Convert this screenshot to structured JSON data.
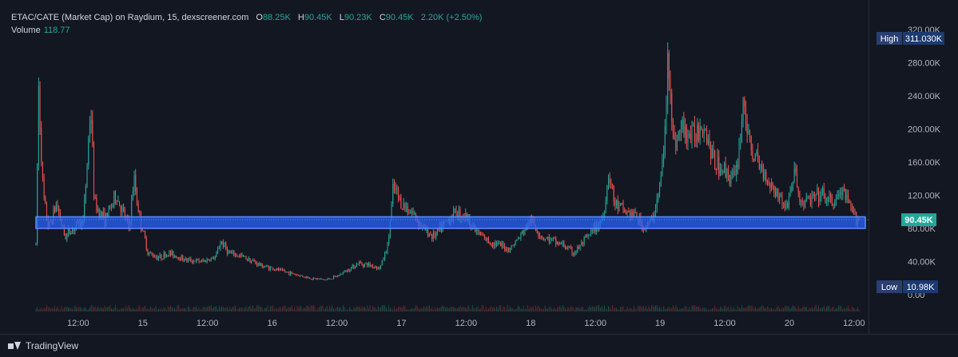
{
  "legend": {
    "symbol": "ETAC/CATE (Market Cap) on Raydium, 15, dexscreener.com",
    "o_key": "O",
    "o_val": "88.25K",
    "h_key": "H",
    "h_val": "90.45K",
    "l_key": "L",
    "l_val": "90.23K",
    "c_key": "C",
    "c_val": "90.45K",
    "change": "2.20K (+2.50%)",
    "volume_label": "Volume",
    "volume_value": "118.77"
  },
  "footer": {
    "brand": "TradingView"
  },
  "icons": {
    "brand_icon": "tradingview-logo-icon"
  },
  "colors": {
    "up": "#26a69a",
    "down": "#ef5350",
    "zone": "#2962ff",
    "background": "#131722"
  },
  "chart_data": {
    "type": "candlestick",
    "ylim": [
      0,
      320000
    ],
    "y_ticks": [
      0,
      40000,
      80000,
      120000,
      160000,
      200000,
      240000,
      280000,
      320000
    ],
    "y_tick_labels": [
      "0.00",
      "40.00K",
      "80.00K",
      "120.00K",
      "160.00K",
      "200.00K",
      "240.00K",
      "280.00K",
      "320.00K"
    ],
    "x_tick_labels": [
      "12:00",
      "15",
      "12:00",
      "16",
      "12:00",
      "17",
      "12:00",
      "18",
      "12:00",
      "19",
      "12:00",
      "20",
      "12:00"
    ],
    "x_tick_times": [
      "2024-05-14T12:00",
      "2024-05-15T00:00",
      "2024-05-15T12:00",
      "2024-05-16T00:00",
      "2024-05-16T12:00",
      "2024-05-17T00:00",
      "2024-05-17T12:00",
      "2024-05-18T00:00",
      "2024-05-18T12:00",
      "2024-05-19T00:00",
      "2024-05-19T12:00",
      "2024-05-20T00:00",
      "2024-05-20T12:00"
    ],
    "x_range": [
      "2024-05-14T04:10",
      "2024-05-20T13:30"
    ],
    "interval_minutes": 15,
    "series": [
      {
        "kind": "ohlc",
        "points": [
          [
            "2024-05-14T04:10",
            60000
          ],
          [
            "2024-05-14T04:40",
            250000
          ],
          [
            "2024-05-14T05:30",
            120000
          ],
          [
            "2024-05-14T06:30",
            80000
          ],
          [
            "2024-05-14T08:00",
            110000
          ],
          [
            "2024-05-14T09:30",
            70000
          ],
          [
            "2024-05-14T11:00",
            80000
          ],
          [
            "2024-05-14T13:00",
            90000
          ],
          [
            "2024-05-14T14:20",
            230000
          ],
          [
            "2024-05-14T15:00",
            110000
          ],
          [
            "2024-05-14T17:00",
            90000
          ],
          [
            "2024-05-14T19:00",
            120000
          ],
          [
            "2024-05-14T21:30",
            80000
          ],
          [
            "2024-05-14T22:20",
            140000
          ],
          [
            "2024-05-14T23:30",
            90000
          ],
          [
            "2024-05-15T01:00",
            50000
          ],
          [
            "2024-05-15T03:00",
            45000
          ],
          [
            "2024-05-15T05:00",
            50000
          ],
          [
            "2024-05-15T08:00",
            42000
          ],
          [
            "2024-05-15T11:00",
            40000
          ],
          [
            "2024-05-15T13:30",
            45000
          ],
          [
            "2024-05-15T14:30",
            65000
          ],
          [
            "2024-05-15T16:00",
            50000
          ],
          [
            "2024-05-15T19:00",
            45000
          ],
          [
            "2024-05-15T22:00",
            35000
          ],
          [
            "2024-05-16T01:00",
            30000
          ],
          [
            "2024-05-16T04:00",
            25000
          ],
          [
            "2024-05-16T07:00",
            20000
          ],
          [
            "2024-05-16T10:00",
            18000
          ],
          [
            "2024-05-16T12:00",
            22000
          ],
          [
            "2024-05-16T14:00",
            30000
          ],
          [
            "2024-05-16T16:00",
            38000
          ],
          [
            "2024-05-16T18:00",
            36000
          ],
          [
            "2024-05-16T20:00",
            32000
          ],
          [
            "2024-05-16T21:30",
            60000
          ],
          [
            "2024-05-16T22:30",
            130000
          ],
          [
            "2024-05-17T00:00",
            110000
          ],
          [
            "2024-05-17T02:00",
            100000
          ],
          [
            "2024-05-17T04:00",
            80000
          ],
          [
            "2024-05-17T06:00",
            70000
          ],
          [
            "2024-05-17T08:00",
            85000
          ],
          [
            "2024-05-17T10:00",
            100000
          ],
          [
            "2024-05-17T12:00",
            95000
          ],
          [
            "2024-05-17T14:00",
            75000
          ],
          [
            "2024-05-17T16:00",
            65000
          ],
          [
            "2024-05-17T18:00",
            60000
          ],
          [
            "2024-05-17T20:00",
            55000
          ],
          [
            "2024-05-17T22:00",
            70000
          ],
          [
            "2024-05-18T00:00",
            90000
          ],
          [
            "2024-05-18T02:00",
            70000
          ],
          [
            "2024-05-18T04:00",
            65000
          ],
          [
            "2024-05-18T06:00",
            60000
          ],
          [
            "2024-05-18T08:00",
            50000
          ],
          [
            "2024-05-18T10:00",
            65000
          ],
          [
            "2024-05-18T12:00",
            80000
          ],
          [
            "2024-05-18T13:30",
            95000
          ],
          [
            "2024-05-18T14:30",
            150000
          ],
          [
            "2024-05-18T15:30",
            110000
          ],
          [
            "2024-05-18T17:30",
            100000
          ],
          [
            "2024-05-18T19:30",
            95000
          ],
          [
            "2024-05-18T21:00",
            80000
          ],
          [
            "2024-05-18T22:30",
            90000
          ],
          [
            "2024-05-19T00:00",
            130000
          ],
          [
            "2024-05-19T01:00",
            200000
          ],
          [
            "2024-05-19T01:30",
            300000
          ],
          [
            "2024-05-19T02:30",
            180000
          ],
          [
            "2024-05-19T04:00",
            200000
          ],
          [
            "2024-05-19T06:00",
            190000
          ],
          [
            "2024-05-19T08:00",
            210000
          ],
          [
            "2024-05-19T10:00",
            160000
          ],
          [
            "2024-05-19T12:00",
            150000
          ],
          [
            "2024-05-19T14:00",
            140000
          ],
          [
            "2024-05-19T15:00",
            200000
          ],
          [
            "2024-05-19T15:30",
            240000
          ],
          [
            "2024-05-19T16:30",
            180000
          ],
          [
            "2024-05-19T18:00",
            160000
          ],
          [
            "2024-05-19T20:00",
            140000
          ],
          [
            "2024-05-19T22:00",
            120000
          ],
          [
            "2024-05-19T23:30",
            105000
          ],
          [
            "2024-05-20T01:00",
            150000
          ],
          [
            "2024-05-20T02:00",
            110000
          ],
          [
            "2024-05-20T04:00",
            115000
          ],
          [
            "2024-05-20T06:00",
            120000
          ],
          [
            "2024-05-20T08:00",
            110000
          ],
          [
            "2024-05-20T10:00",
            125000
          ],
          [
            "2024-05-20T11:30",
            100000
          ],
          [
            "2024-05-20T13:00",
            90450
          ]
        ]
      }
    ],
    "last_price": 90450,
    "last_price_label": "90.45K",
    "high_label": "High",
    "high_value": 311030,
    "high_value_label": "311.030K",
    "low_label": "Low",
    "low_value": 10980,
    "low_value_label": "10.98K",
    "zone": {
      "y_range": [
        80000,
        94000
      ],
      "x_range": [
        "2024-05-14T04:10",
        "2024-05-20T14:30"
      ]
    }
  }
}
